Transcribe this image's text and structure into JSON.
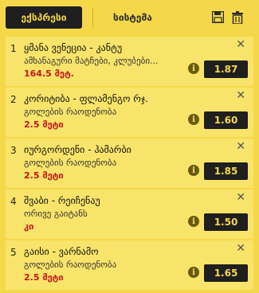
{
  "tabs": {
    "express_label": "ექსპრესი",
    "system_label": "სისტემა"
  },
  "header": {
    "save_icon": "save-icon",
    "trash_icon": "trash-icon"
  },
  "bets": [
    {
      "index": "1",
      "match": "ყმანა ვენეცია - კანტუ",
      "market": "ამხანაგური მატჩები, კლუბები...",
      "pick": "164.5 მეტ.",
      "odds": "1.87"
    },
    {
      "index": "2",
      "match": "კორიტიბა - ფლამენგო რჯ.",
      "market": "გოლების რაოდენობა",
      "pick": "2.5 მეტი",
      "odds": "1.60"
    },
    {
      "index": "3",
      "match": "იურგორდენი - ჰამარბი",
      "market": "გოლების რაოდენობა",
      "pick": "2.5 მეტი",
      "odds": "1.85"
    },
    {
      "index": "4",
      "match": "შვაბი - რეიჩენაუ",
      "market": "ორივე გაიტანს",
      "pick": "კი",
      "odds": "1.50"
    },
    {
      "index": "5",
      "match": "გაისი - ვარნამო",
      "market": "გოლების რაოდენობა",
      "pick": "2.5 მეტი",
      "odds": "1.65"
    }
  ],
  "colors": {
    "background": "#f5d84a",
    "card": "#f8e46a",
    "dark": "#1f1f1f",
    "pick_red": "#c8141e"
  }
}
